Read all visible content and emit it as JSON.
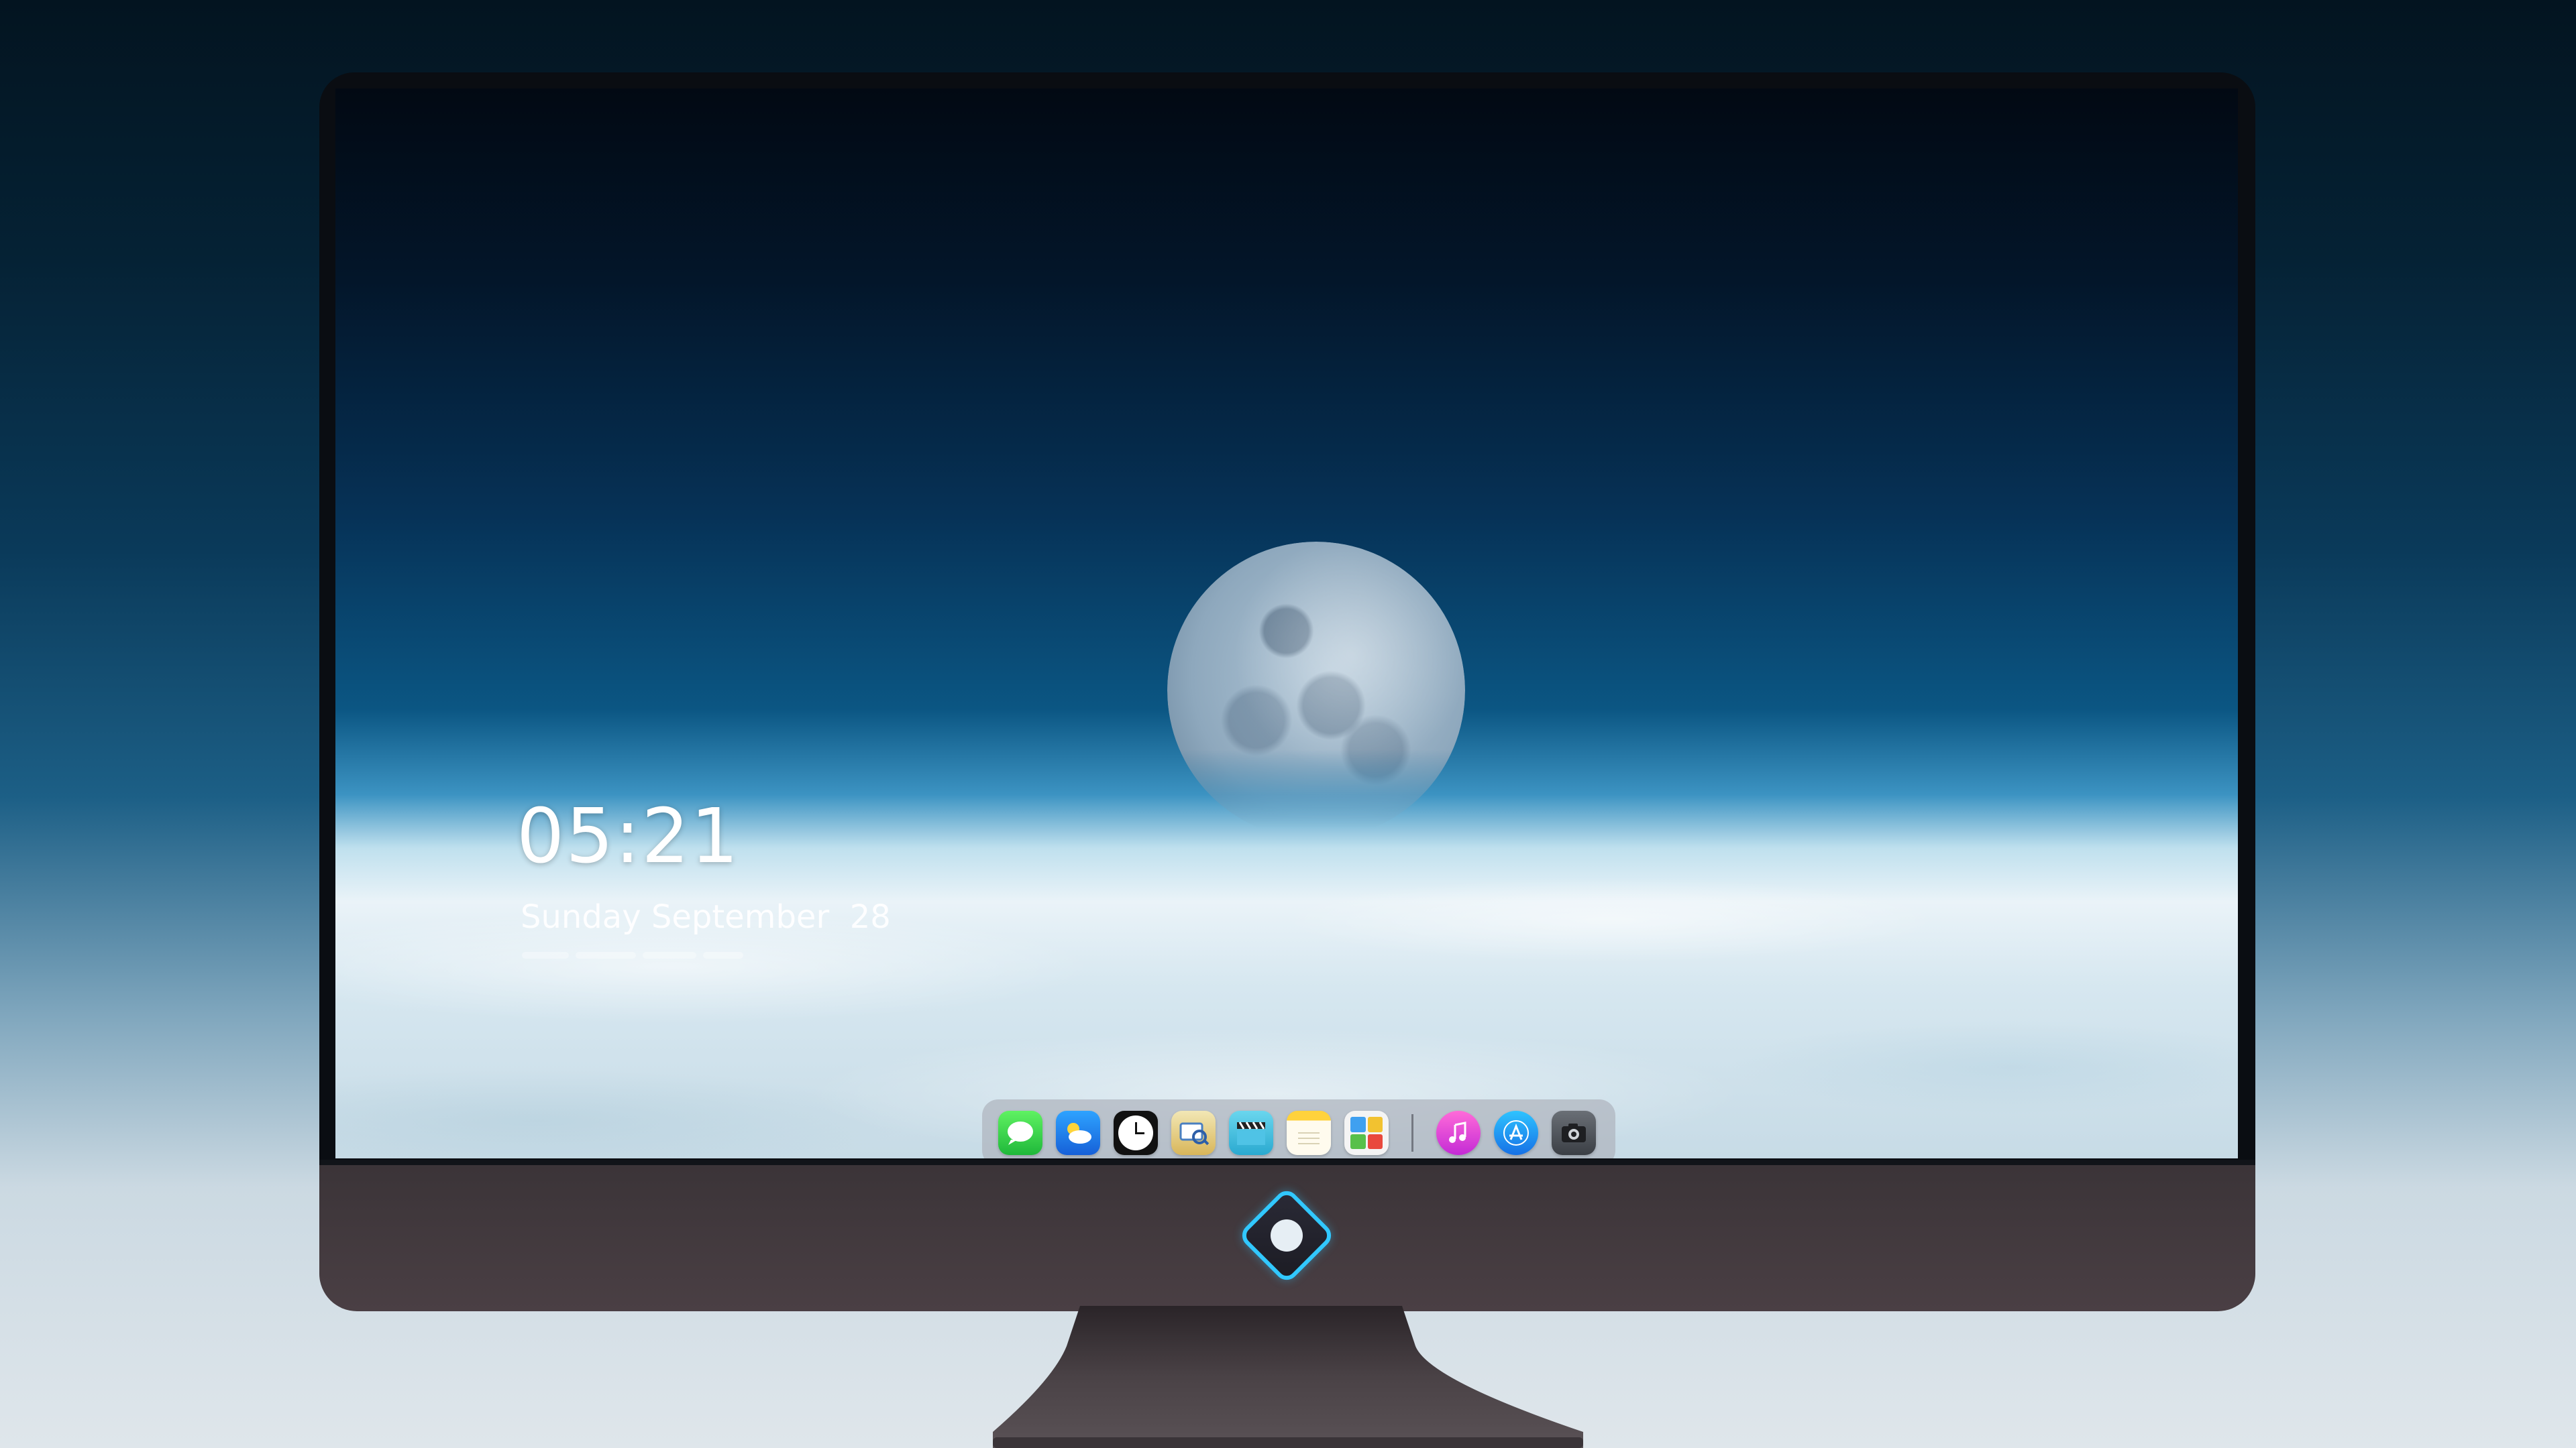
{
  "lockscreen": {
    "time": "05:21",
    "date": "Sunday September  28"
  },
  "dock": {
    "apps": [
      {
        "name": "messages-icon",
        "label": ""
      },
      {
        "name": "weather-icon",
        "label": ""
      },
      {
        "name": "clock-icon",
        "label": ""
      },
      {
        "name": "preview-icon",
        "label": ""
      },
      {
        "name": "movie-clapper-icon",
        "label": ""
      },
      {
        "name": "notes-icon",
        "label": ""
      },
      {
        "name": "photos-icon",
        "label": ""
      },
      {
        "name": "music-icon",
        "label": ""
      },
      {
        "name": "app-store-icon",
        "label": ""
      },
      {
        "name": "camera-icon",
        "label": ""
      }
    ]
  },
  "colors": {
    "brand_accent": "#31c8ff",
    "dock_bg": "#b0b4be",
    "chin": "#433a3f"
  }
}
